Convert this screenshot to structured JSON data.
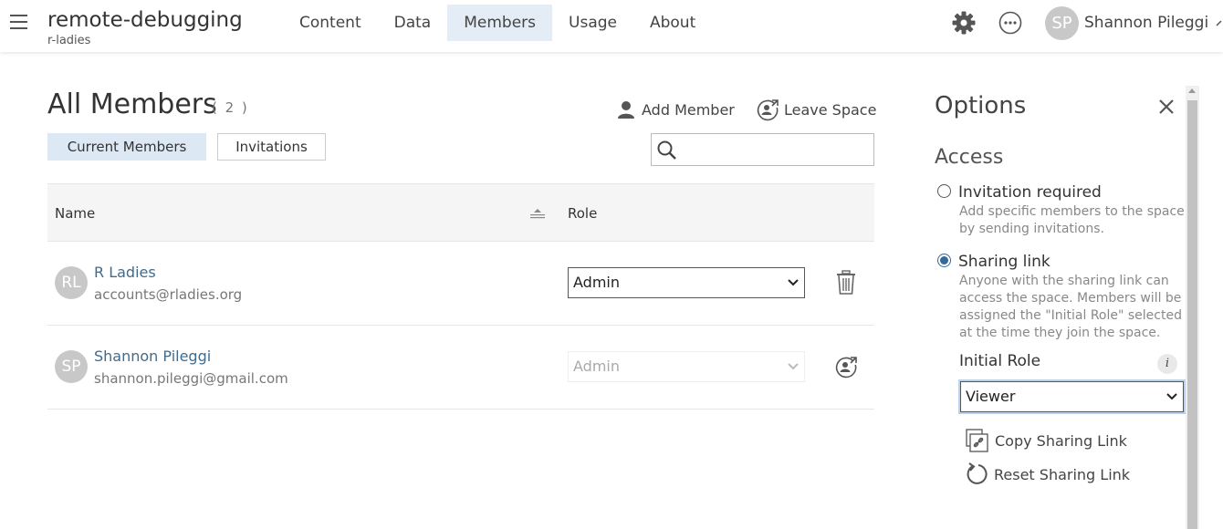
{
  "header": {
    "project_title": "remote-debugging",
    "project_sub": "r-ladies",
    "nav": [
      "Content",
      "Data",
      "Members",
      "Usage",
      "About"
    ],
    "active_nav": "Members",
    "user_initials": "SP",
    "user_name": "Shannon Pileggi"
  },
  "members": {
    "title": "All Members",
    "count": "( 2 )",
    "add_member": "Add Member",
    "leave_space": "Leave Space",
    "tabs": [
      "Current Members",
      "Invitations"
    ],
    "search_placeholder": "",
    "col_name": "Name",
    "col_role": "Role",
    "rows": [
      {
        "initials": "RL",
        "name": "R Ladies",
        "email": "accounts@rladies.org",
        "role": "Admin",
        "action": "delete"
      },
      {
        "initials": "SP",
        "name": "Shannon Pileggi",
        "email": "shannon.pileggi@gmail.com",
        "role": "Admin",
        "action": "leave"
      }
    ]
  },
  "options": {
    "title": "Options",
    "access_title": "Access",
    "invitation_label": "Invitation required",
    "invitation_desc": "Add specific members to the space by sending invitations.",
    "sharing_label": "Sharing link",
    "sharing_desc": "Anyone with the sharing link can access the space. Members will be assigned the \"Initial Role\" selected at the time they join the space.",
    "initial_role_label": "Initial Role",
    "initial_role_value": "Viewer",
    "copy_link": "Copy Sharing Link",
    "reset_link": "Reset Sharing Link",
    "selected_access": "sharing"
  },
  "icons": [
    "hamburger-icon",
    "gear-icon",
    "more-icon",
    "person-icon",
    "leave-icon",
    "search-icon",
    "sort-icon",
    "trash-icon",
    "close-icon",
    "info-icon",
    "copy-link-icon",
    "reset-icon",
    "chevron-down-icon"
  ],
  "colors": {
    "accent": "#35679a",
    "active_tab": "#dce8f4",
    "link": "#3f6b8f"
  }
}
